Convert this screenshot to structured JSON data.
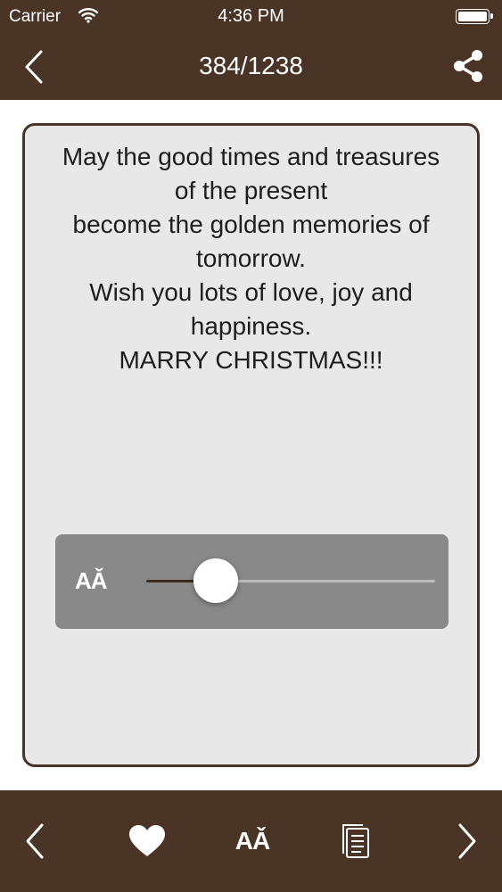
{
  "status_bar": {
    "carrier": "Carrier",
    "time": "4:36 PM",
    "battery_level": 1.0
  },
  "nav": {
    "page_counter": "384/1238",
    "back_icon": "chevron-left-icon",
    "share_icon": "share-icon"
  },
  "card": {
    "quote": "May the good times and treasures\nof the present\nbecome the golden memories of\ntomorrow.\nWish you lots of love, joy and\nhappiness.\nMARRY CHRISTMAS!!!"
  },
  "font_panel": {
    "icon_label": "AǍ",
    "slider_value": 0.24
  },
  "toolbar": {
    "font_label": "AǍ",
    "icons": [
      "chevron-left-icon",
      "heart-icon",
      "font-size-icon",
      "copy-icon",
      "chevron-right-icon"
    ]
  },
  "colors": {
    "bar_brown": "#4a3426",
    "card_background": "#e8e8e8",
    "panel_gray": "#898989"
  }
}
